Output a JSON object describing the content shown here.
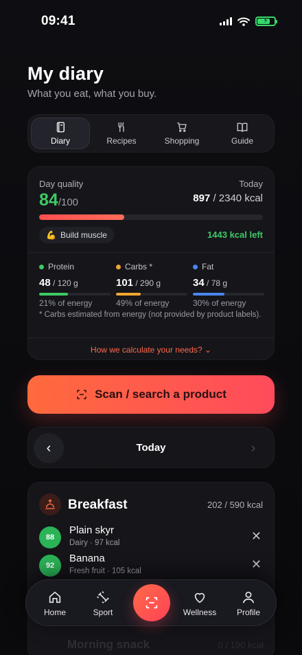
{
  "status": {
    "time": "09:41"
  },
  "header": {
    "title": "My diary",
    "subtitle": "What you eat, what you buy."
  },
  "tabs": [
    {
      "label": "Diary",
      "icon": "notebook-icon",
      "active": true
    },
    {
      "label": "Recipes",
      "icon": "fork-knife-icon"
    },
    {
      "label": "Shopping",
      "icon": "cart-icon"
    },
    {
      "label": "Guide",
      "icon": "book-icon"
    }
  ],
  "quality": {
    "label": "Day quality",
    "score": "84",
    "score_max": "/100",
    "today_label": "Today",
    "kcal_eaten": "897",
    "kcal_goal": " / 2340 kcal",
    "progress": 0.38,
    "goal_emoji": "💪",
    "goal": "Build muscle",
    "kcal_left": "1443 kcal left",
    "macros": [
      {
        "name": "Protein",
        "value": "48",
        "target": " / 120 g",
        "pct": "21% of energy",
        "color": "#3ec964",
        "fill": 0.4
      },
      {
        "name": "Carbs *",
        "value": "101",
        "target": " / 290 g",
        "pct": "49% of energy",
        "color": "#f2a531",
        "fill": 0.35
      },
      {
        "name": "Fat",
        "value": "34",
        "target": " / 78 g",
        "pct": "30% of energy",
        "color": "#4a86f0",
        "fill": 0.44
      }
    ],
    "note": "* Carbs estimated from energy (not provided by product labels).",
    "how_link": "How we calculate your needs? ⌄"
  },
  "scan": {
    "label": "Scan / search a product"
  },
  "datenav": {
    "label": "Today",
    "prev": "‹",
    "next": "›"
  },
  "meal": {
    "title": "Breakfast",
    "kcal": "202 / 590 kcal",
    "items": [
      {
        "score": "88",
        "name": "Plain skyr",
        "meta": "Dairy · 97 kcal"
      },
      {
        "score": "92",
        "name": "Banana",
        "meta": "Fresh fruit · 105 kcal"
      }
    ]
  },
  "next_meal": {
    "title": "Morning snack",
    "kcal": "0 / 190 kcal"
  },
  "bottom_nav": [
    {
      "label": "Home",
      "icon": "home-icon"
    },
    {
      "label": "Sport",
      "icon": "dumbbell-icon"
    },
    {
      "label": "Wellness",
      "icon": "heart-icon"
    },
    {
      "label": "Profile",
      "icon": "user-icon"
    }
  ],
  "colors": {
    "accent": "#ff5a4d",
    "good": "#3ec964",
    "bg": "#0e0e12"
  }
}
